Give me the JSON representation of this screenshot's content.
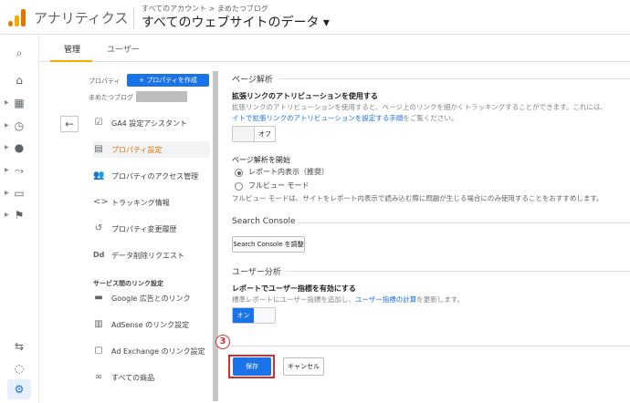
{
  "header": {
    "app_name": "アナリティクス",
    "breadcrumb": "すべてのアカウント > まめたつブログ",
    "property_title": "すべてのウェブサイトのデータ ▾"
  },
  "tabs": [
    {
      "label": "管理"
    },
    {
      "label": "ユーザー"
    }
  ],
  "property_column": {
    "label": "プロパティ",
    "create_button": "+ プロパティを作成",
    "property_name": "まめたつブログ",
    "menu": [
      {
        "label": "GA4 設定アシスタント",
        "icon": "checkbox-icon"
      },
      {
        "label": "プロパティ設定",
        "icon": "settings-page-icon"
      },
      {
        "label": "プロパティのアクセス管理",
        "icon": "people-icon"
      },
      {
        "label": "トラッキング情報",
        "icon": "code-icon"
      },
      {
        "label": "プロパティ変更履歴",
        "icon": "history-icon"
      },
      {
        "label": "データ削除リクエスト",
        "icon": "dd-icon"
      }
    ],
    "link_section_title": "サービス間のリンク設定",
    "links": [
      {
        "label": "Google 広告とのリンク",
        "icon": "ads-icon"
      },
      {
        "label": "AdSense のリンク設定",
        "icon": "adsense-icon"
      },
      {
        "label": "Ad Exchange のリンク設定",
        "icon": "adx-icon"
      },
      {
        "label": "すべての商品",
        "icon": "all-products-icon"
      }
    ]
  },
  "main": {
    "page_analysis_title": "ページ解析",
    "enhanced_link_title": "拡張リンクのアトリビューションを使用する",
    "enhanced_link_desc1": "拡張リンクのアトリビューションを使用すると、ページ上のリンクを細かくトラッキングすることができます。これには、",
    "enhanced_link_desc2_link": "イトで拡張リンクのアトリビューションを設定する手順",
    "enhanced_link_desc2_tail": "をご覧ください。",
    "enhanced_toggle_off": "オフ",
    "page_analysis_start_title": "ページ解析を開始",
    "radio_report": "レポート内表示（推奨）",
    "radio_full": "フルビュー モード",
    "full_view_desc": "フルビュー モードは、サイトをレポート内表示で読み込む際に問題が生じる場合にのみ使用することをおすすめします。",
    "search_console_title": "Search Console",
    "search_console_button": "Search Console を調整",
    "user_analysis_title": "ユーザー分析",
    "user_metric_title": "レポートでユーザー指標を有効にする",
    "user_metric_desc_head": "標準レポートにユーザー指標を追加し、",
    "user_metric_desc_link": "ユーザー指標の計算",
    "user_metric_desc_tail": "を更新します。",
    "user_toggle_on": "オン"
  },
  "actions": {
    "step_number": "3",
    "save": "保存",
    "cancel": "キャンセル"
  },
  "colors": {
    "accent": "#1a73e8",
    "highlight": "#d32f2f",
    "active_menu": "#e37400",
    "tab_underline": "#f9ab00"
  }
}
